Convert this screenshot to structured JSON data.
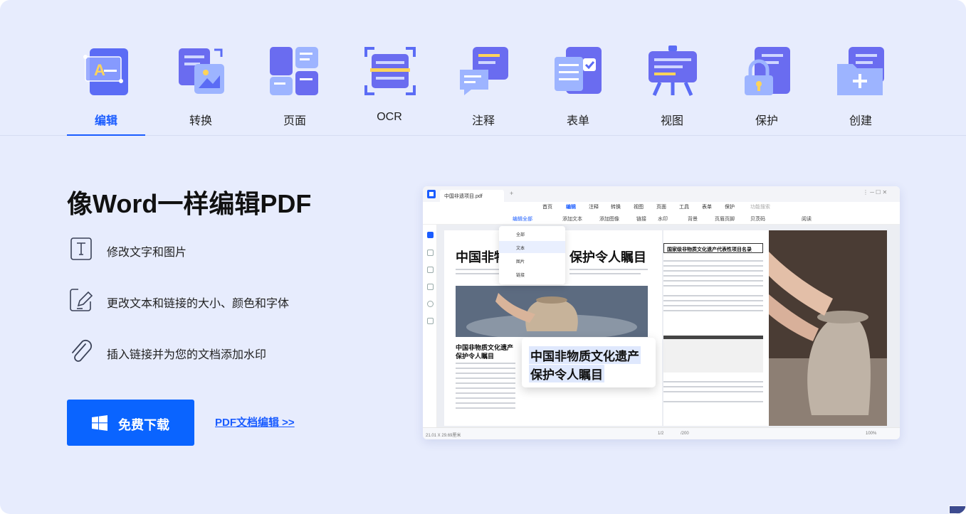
{
  "tabs": [
    {
      "label": "编辑",
      "icon": "edit-icon",
      "active": true
    },
    {
      "label": "转换",
      "icon": "convert-icon",
      "active": false
    },
    {
      "label": "页面",
      "icon": "pages-icon",
      "active": false
    },
    {
      "label": "OCR",
      "icon": "ocr-icon",
      "active": false
    },
    {
      "label": "注释",
      "icon": "annotate-icon",
      "active": false
    },
    {
      "label": "表单",
      "icon": "form-icon",
      "active": false
    },
    {
      "label": "视图",
      "icon": "view-icon",
      "active": false
    },
    {
      "label": "保护",
      "icon": "protect-icon",
      "active": false
    },
    {
      "label": "创建",
      "icon": "create-icon",
      "active": false
    }
  ],
  "hero": {
    "headline": "像Word一样编辑PDF",
    "features": [
      {
        "icon": "text-box-icon",
        "text": "修改文字和图片"
      },
      {
        "icon": "edit-pen-icon",
        "text": "更改文本和链接的大小、颜色和字体"
      },
      {
        "icon": "paperclip-icon",
        "text": "插入链接并为您的文档添加水印"
      }
    ],
    "download_label": "免费下载",
    "more_link": "PDF文档编辑 >>"
  },
  "app": {
    "doc_tab": "中国非遗项目.pdf",
    "menus": [
      "首页",
      "编辑",
      "注释",
      "转换",
      "视图",
      "页面",
      "工具",
      "表单",
      "保护",
      "功能搜索"
    ],
    "toolbar": [
      "编辑全部",
      "添加文本",
      "添加图像",
      "链接",
      "水印",
      "背景",
      "页眉页脚",
      "贝茨码",
      "阅读"
    ],
    "dropdown": [
      "全部",
      "文本",
      "图片",
      "链接"
    ],
    "page_title_left": "中国非物",
    "page_title_right": "保护令人瞩目",
    "section_title": "中国非物质文化遗产",
    "section_title_2": "保护令人瞩目",
    "right_title": "国家级非物质文化遗产代表性项目名录",
    "callout_line1": "中国非物质文化遗产",
    "callout_line2": "保护令人瞩目",
    "status_size": "21.01 X 29.69厘米",
    "status_page": "1/2",
    "status_total": "/200",
    "status_zoom": "100%"
  },
  "colors": {
    "accent": "#1a5cff",
    "button": "#0a64ff",
    "background": "#e7ecfd"
  }
}
